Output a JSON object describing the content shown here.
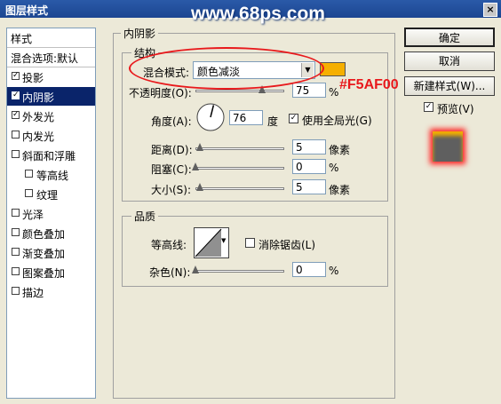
{
  "window": {
    "title": "图层样式",
    "watermark": "www.68ps.com",
    "close": "×"
  },
  "sidebar": {
    "header": "样式",
    "blend_options": "混合选项:默认",
    "items": [
      {
        "label": "投影",
        "checked": true
      },
      {
        "label": "内阴影",
        "checked": true,
        "selected": true
      },
      {
        "label": "外发光",
        "checked": true
      },
      {
        "label": "内发光",
        "checked": false
      },
      {
        "label": "斜面和浮雕",
        "checked": false
      },
      {
        "label": "等高线",
        "checked": false,
        "indent": true
      },
      {
        "label": "纹理",
        "checked": false,
        "indent": true
      },
      {
        "label": "光泽",
        "checked": false
      },
      {
        "label": "颜色叠加",
        "checked": false
      },
      {
        "label": "渐变叠加",
        "checked": false
      },
      {
        "label": "图案叠加",
        "checked": false
      },
      {
        "label": "描边",
        "checked": false
      }
    ]
  },
  "panel": {
    "title": "内阴影",
    "structure": {
      "title": "结构",
      "blend_mode_label": "混合模式:",
      "blend_mode_value": "颜色减淡",
      "color": "#F5AF00",
      "opacity_label": "不透明度(O):",
      "opacity_value": "75",
      "opacity_unit": "%",
      "angle_label": "角度(A):",
      "angle_value": "76",
      "angle_unit": "度",
      "global_light_label": "使用全局光(G)",
      "global_light_checked": true,
      "distance_label": "距离(D):",
      "distance_value": "5",
      "distance_unit": "像素",
      "choke_label": "阻塞(C):",
      "choke_value": "0",
      "choke_unit": "%",
      "size_label": "大小(S):",
      "size_value": "5",
      "size_unit": "像素"
    },
    "quality": {
      "title": "品质",
      "contour_label": "等高线:",
      "antialias_label": "消除锯齿(L)",
      "antialias_checked": false,
      "noise_label": "杂色(N):",
      "noise_value": "0",
      "noise_unit": "%"
    }
  },
  "annotation": {
    "color_hex_text": "#F5AF00",
    "color": "#E8191C"
  },
  "buttons": {
    "ok": "确定",
    "cancel": "取消",
    "new_style": "新建样式(W)...",
    "preview_label": "预览(V)",
    "preview_checked": true
  }
}
